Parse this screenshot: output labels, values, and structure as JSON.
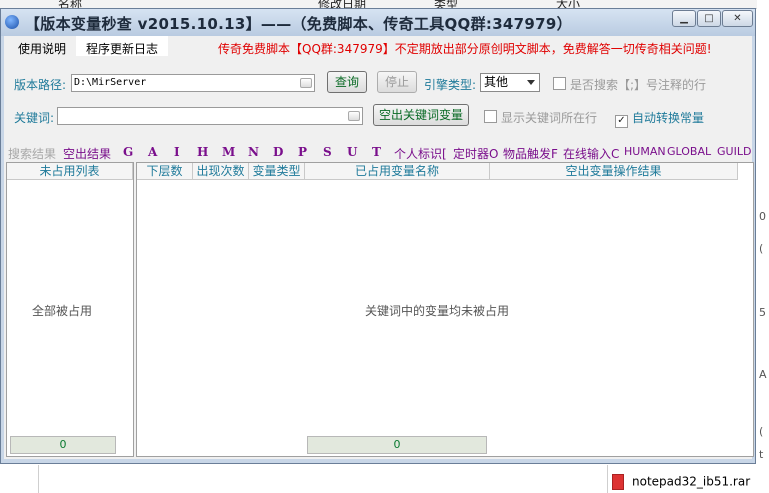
{
  "background": {
    "columns": [
      "名称",
      "修改日期",
      "类型",
      "大小"
    ],
    "file_name": "notepad32_ib51.rar",
    "side_chars": [
      "0",
      "(",
      "5",
      "A",
      "(",
      "t"
    ]
  },
  "window": {
    "title": "【版本变量秒查 v2015.10.13】——（免费脚本、传奇工具QQ群:347979）",
    "min_glyph": "▁",
    "max_glyph": "□",
    "close_glyph": "✕"
  },
  "menu": {
    "items": [
      "使用说明",
      "程序更新日志"
    ],
    "notice": "传奇免费脚本【QQ群:347979】不定期放出部分原创明文脚本，免费解答一切传奇相关问题!"
  },
  "form": {
    "path_label": "版本路径:",
    "path_value": "D:\\MirServer",
    "query_btn": "查询",
    "stop_btn": "停止",
    "engine_label": "引擎类型:",
    "engine_value": "其他",
    "search_comment_label": "是否搜索【;】号注释的行",
    "keyword_label": "关键词:",
    "keyword_value": "",
    "empty_btn": "空出关键词变量",
    "show_rows_label": "显示关键词所在行",
    "auto_convert_label": "自动转换常量",
    "auto_convert_checked": true,
    "show_rows_checked": false,
    "search_comment_checked": false
  },
  "filters": {
    "label": "搜索结果",
    "items": [
      "空出结果",
      "G",
      "A",
      "I",
      "H",
      "M",
      "N",
      "D",
      "P",
      "S",
      "U",
      "T",
      "个人标识[",
      "定时器O",
      "物品触发F",
      "在线输入C",
      "HUMAN",
      "GLOBAL",
      "GUILD"
    ]
  },
  "left_pane": {
    "header": "未占用列表",
    "empty_text": "全部被占用",
    "count": "0"
  },
  "right_pane": {
    "headers": [
      "下层数",
      "出现次数",
      "变量类型",
      "已占用变量名称",
      "空出变量操作结果"
    ],
    "empty_text": "关键词中的变量均未被占用",
    "count": "0"
  },
  "colors": {
    "label_teal": "#1f7a9a",
    "notice_red": "#e00000",
    "filter_purple": "#7a0f8c",
    "button_green": "#0a6a25"
  },
  "icons": [
    "app-icon",
    "combo-icon",
    "minimize-icon",
    "maximize-icon",
    "close-icon",
    "file-icon"
  ]
}
